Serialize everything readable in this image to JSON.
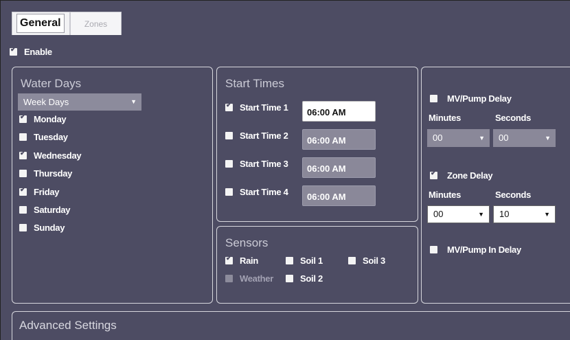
{
  "tabs": {
    "general": "General",
    "zones": "Zones"
  },
  "enable": {
    "label": "Enable",
    "checked": true
  },
  "water_days": {
    "title": "Water Days",
    "mode": "Week Days",
    "days": [
      {
        "label": "Monday",
        "checked": true
      },
      {
        "label": "Tuesday",
        "checked": false
      },
      {
        "label": "Wednesday",
        "checked": true
      },
      {
        "label": "Thursday",
        "checked": false
      },
      {
        "label": "Friday",
        "checked": true
      },
      {
        "label": "Saturday",
        "checked": false
      },
      {
        "label": "Sunday",
        "checked": false
      }
    ]
  },
  "start_times": {
    "title": "Start Times",
    "items": [
      {
        "label": "Start Time 1",
        "value": "06:00 AM",
        "checked": true
      },
      {
        "label": "Start Time 2",
        "value": "06:00 AM",
        "checked": false
      },
      {
        "label": "Start Time 3",
        "value": "06:00 AM",
        "checked": false
      },
      {
        "label": "Start Time 4",
        "value": "06:00 AM",
        "checked": false
      }
    ]
  },
  "sensors": {
    "title": "Sensors",
    "rain": {
      "label": "Rain",
      "checked": true
    },
    "weather": {
      "label": "Weather",
      "checked": false
    },
    "soil1": {
      "label": "Soil 1",
      "checked": false
    },
    "soil2": {
      "label": "Soil 2",
      "checked": false
    },
    "soil3": {
      "label": "Soil 3",
      "checked": false
    }
  },
  "delays": {
    "mv_pump_delay": {
      "label": "MV/Pump Delay",
      "checked": false
    },
    "mv_minutes_label": "Minutes",
    "mv_seconds_label": "Seconds",
    "mv_minutes": "00",
    "mv_seconds": "00",
    "zone_delay": {
      "label": "Zone Delay",
      "checked": true
    },
    "zone_minutes_label": "Minutes",
    "zone_seconds_label": "Seconds",
    "zone_minutes": "00",
    "zone_seconds": "10",
    "mv_pump_in_delay": {
      "label": "MV/Pump In Delay",
      "checked": false
    }
  },
  "advanced": {
    "title": "Advanced Settings"
  },
  "colors": {
    "background": "#4d4c63",
    "field_disabled": "#8a8899",
    "text": "#ffffff"
  }
}
